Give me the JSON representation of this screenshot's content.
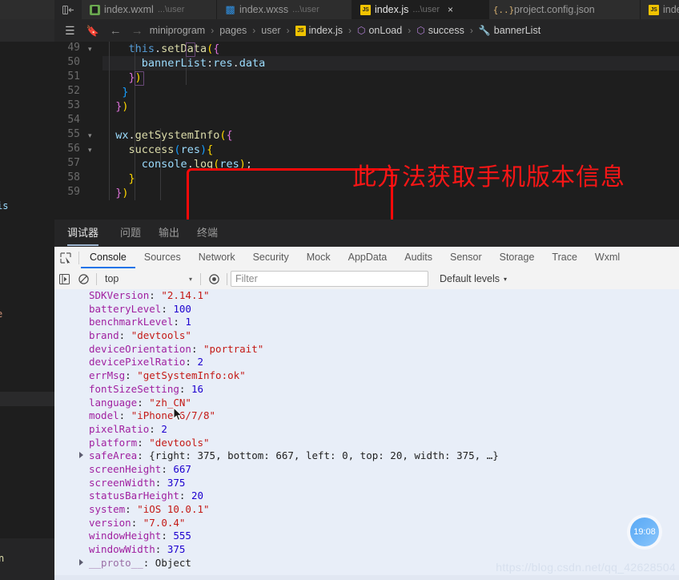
{
  "editor_window": {
    "collapse_icon": "collapse-sidebar-icon",
    "tabs": [
      {
        "label": "index.wxml",
        "sub": "...\\user",
        "icon": "wxml-file-icon",
        "active": false,
        "closable": false
      },
      {
        "label": "index.wxss",
        "sub": "...\\user",
        "icon": "wxss-file-icon",
        "active": false,
        "closable": false
      },
      {
        "label": "index.js",
        "sub": "...\\user",
        "icon": "js-file-icon",
        "active": true,
        "closable": true,
        "close_label": "×"
      },
      {
        "label": "project.config.json",
        "sub": "",
        "icon": "json-file-icon",
        "active": false,
        "closable": false
      },
      {
        "label": "index.j",
        "sub": "",
        "icon": "js-file-icon",
        "active": false,
        "closable": false
      }
    ],
    "breadcrumb": {
      "list_icon": "list-icon",
      "bookmark_icon": "bookmark-icon",
      "back_icon": "arrow-left-icon",
      "forward_icon": "arrow-right-icon",
      "items": [
        {
          "label": "miniprogram",
          "icon": ""
        },
        {
          "label": "pages",
          "icon": ""
        },
        {
          "label": "user",
          "icon": ""
        },
        {
          "label": "index.js",
          "icon": "js-file-icon"
        },
        {
          "label": "onLoad",
          "icon": "cube-icon"
        },
        {
          "label": "success",
          "icon": "cube-icon"
        },
        {
          "label": "bannerList",
          "icon": "wrench-icon"
        }
      ],
      "separator": "›"
    }
  },
  "code": {
    "line_numbers": [
      "49",
      "50",
      "51",
      "52",
      "53",
      "54",
      "55",
      "56",
      "57",
      "58",
      "59"
    ],
    "fold_lines": [
      "49",
      "55",
      "56"
    ],
    "highlighted_line": "50",
    "lines": [
      "            this.setData({",
      "              bannerList:res.data",
      "            })",
      "          }",
      "        })",
      "",
      "        wx.getSystemInfo({",
      "          success(res){",
      "            console.log(res);",
      "          }",
      "        })"
    ]
  },
  "annotation": {
    "text": "此方法获取手机版本信息",
    "color": "#f71616",
    "box_color": "#fb0909"
  },
  "panel_tabs": {
    "items": [
      "调试器",
      "问题",
      "输出",
      "终端"
    ],
    "active_index": 0
  },
  "devtools": {
    "inspect_icon": "inspect-element-icon",
    "tabs": [
      "Console",
      "Sources",
      "Network",
      "Security",
      "Mock",
      "AppData",
      "Audits",
      "Sensor",
      "Storage",
      "Trace",
      "Wxml"
    ],
    "active_tab": "Console",
    "active_color": "#1a73e8",
    "toolbar": {
      "sidebar_icon": "console-sidebar-icon",
      "clear_icon": "clear-console-icon",
      "context": "top",
      "context_caret": "▾",
      "eye_icon": "live-expression-icon",
      "filter_placeholder": "Filter",
      "filter_value": "",
      "levels_label": "Default levels",
      "levels_caret": "▾"
    },
    "console_rows": [
      {
        "expandable": false,
        "name": "SDKVersion",
        "sep": ": ",
        "value": "\"2.14.1\"",
        "vtype": "str"
      },
      {
        "expandable": false,
        "name": "batteryLevel",
        "sep": ": ",
        "value": "100",
        "vtype": "num"
      },
      {
        "expandable": false,
        "name": "benchmarkLevel",
        "sep": ": ",
        "value": "1",
        "vtype": "num"
      },
      {
        "expandable": false,
        "name": "brand",
        "sep": ": ",
        "value": "\"devtools\"",
        "vtype": "str"
      },
      {
        "expandable": false,
        "name": "deviceOrientation",
        "sep": ": ",
        "value": "\"portrait\"",
        "vtype": "str"
      },
      {
        "expandable": false,
        "name": "devicePixelRatio",
        "sep": ": ",
        "value": "2",
        "vtype": "num"
      },
      {
        "expandable": false,
        "name": "errMsg",
        "sep": ": ",
        "value": "\"getSystemInfo:ok\"",
        "vtype": "str"
      },
      {
        "expandable": false,
        "name": "fontSizeSetting",
        "sep": ": ",
        "value": "16",
        "vtype": "num"
      },
      {
        "expandable": false,
        "name": "language",
        "sep": ": ",
        "value": "\"zh_CN\"",
        "vtype": "str"
      },
      {
        "expandable": false,
        "name": "model",
        "sep": ": ",
        "value": "\"iPhone 6/7/8\"",
        "vtype": "str"
      },
      {
        "expandable": false,
        "name": "pixelRatio",
        "sep": ": ",
        "value": "2",
        "vtype": "num"
      },
      {
        "expandable": false,
        "name": "platform",
        "sep": ": ",
        "value": "\"devtools\"",
        "vtype": "str"
      },
      {
        "expandable": true,
        "name": "safeArea",
        "sep": ": ",
        "value": "{right: 375, bottom: 667, left: 0, top: 20, width: 375, …}",
        "vtype": "obj"
      },
      {
        "expandable": false,
        "name": "screenHeight",
        "sep": ": ",
        "value": "667",
        "vtype": "num"
      },
      {
        "expandable": false,
        "name": "screenWidth",
        "sep": ": ",
        "value": "375",
        "vtype": "num"
      },
      {
        "expandable": false,
        "name": "statusBarHeight",
        "sep": ": ",
        "value": "20",
        "vtype": "num"
      },
      {
        "expandable": false,
        "name": "system",
        "sep": ": ",
        "value": "\"iOS 10.0.1\"",
        "vtype": "str"
      },
      {
        "expandable": false,
        "name": "version",
        "sep": ": ",
        "value": "\"7.0.4\"",
        "vtype": "str"
      },
      {
        "expandable": false,
        "name": "windowHeight",
        "sep": ": ",
        "value": "555",
        "vtype": "num"
      },
      {
        "expandable": false,
        "name": "windowWidth",
        "sep": ": ",
        "value": "375",
        "vtype": "num"
      },
      {
        "expandable": true,
        "name": "__proto__",
        "sep": ": ",
        "value": "Object",
        "vtype": "proto"
      }
    ]
  },
  "overlay": {
    "watermark": "https://blog.csdn.net/qq_42628504",
    "time_badge": "19:08"
  }
}
